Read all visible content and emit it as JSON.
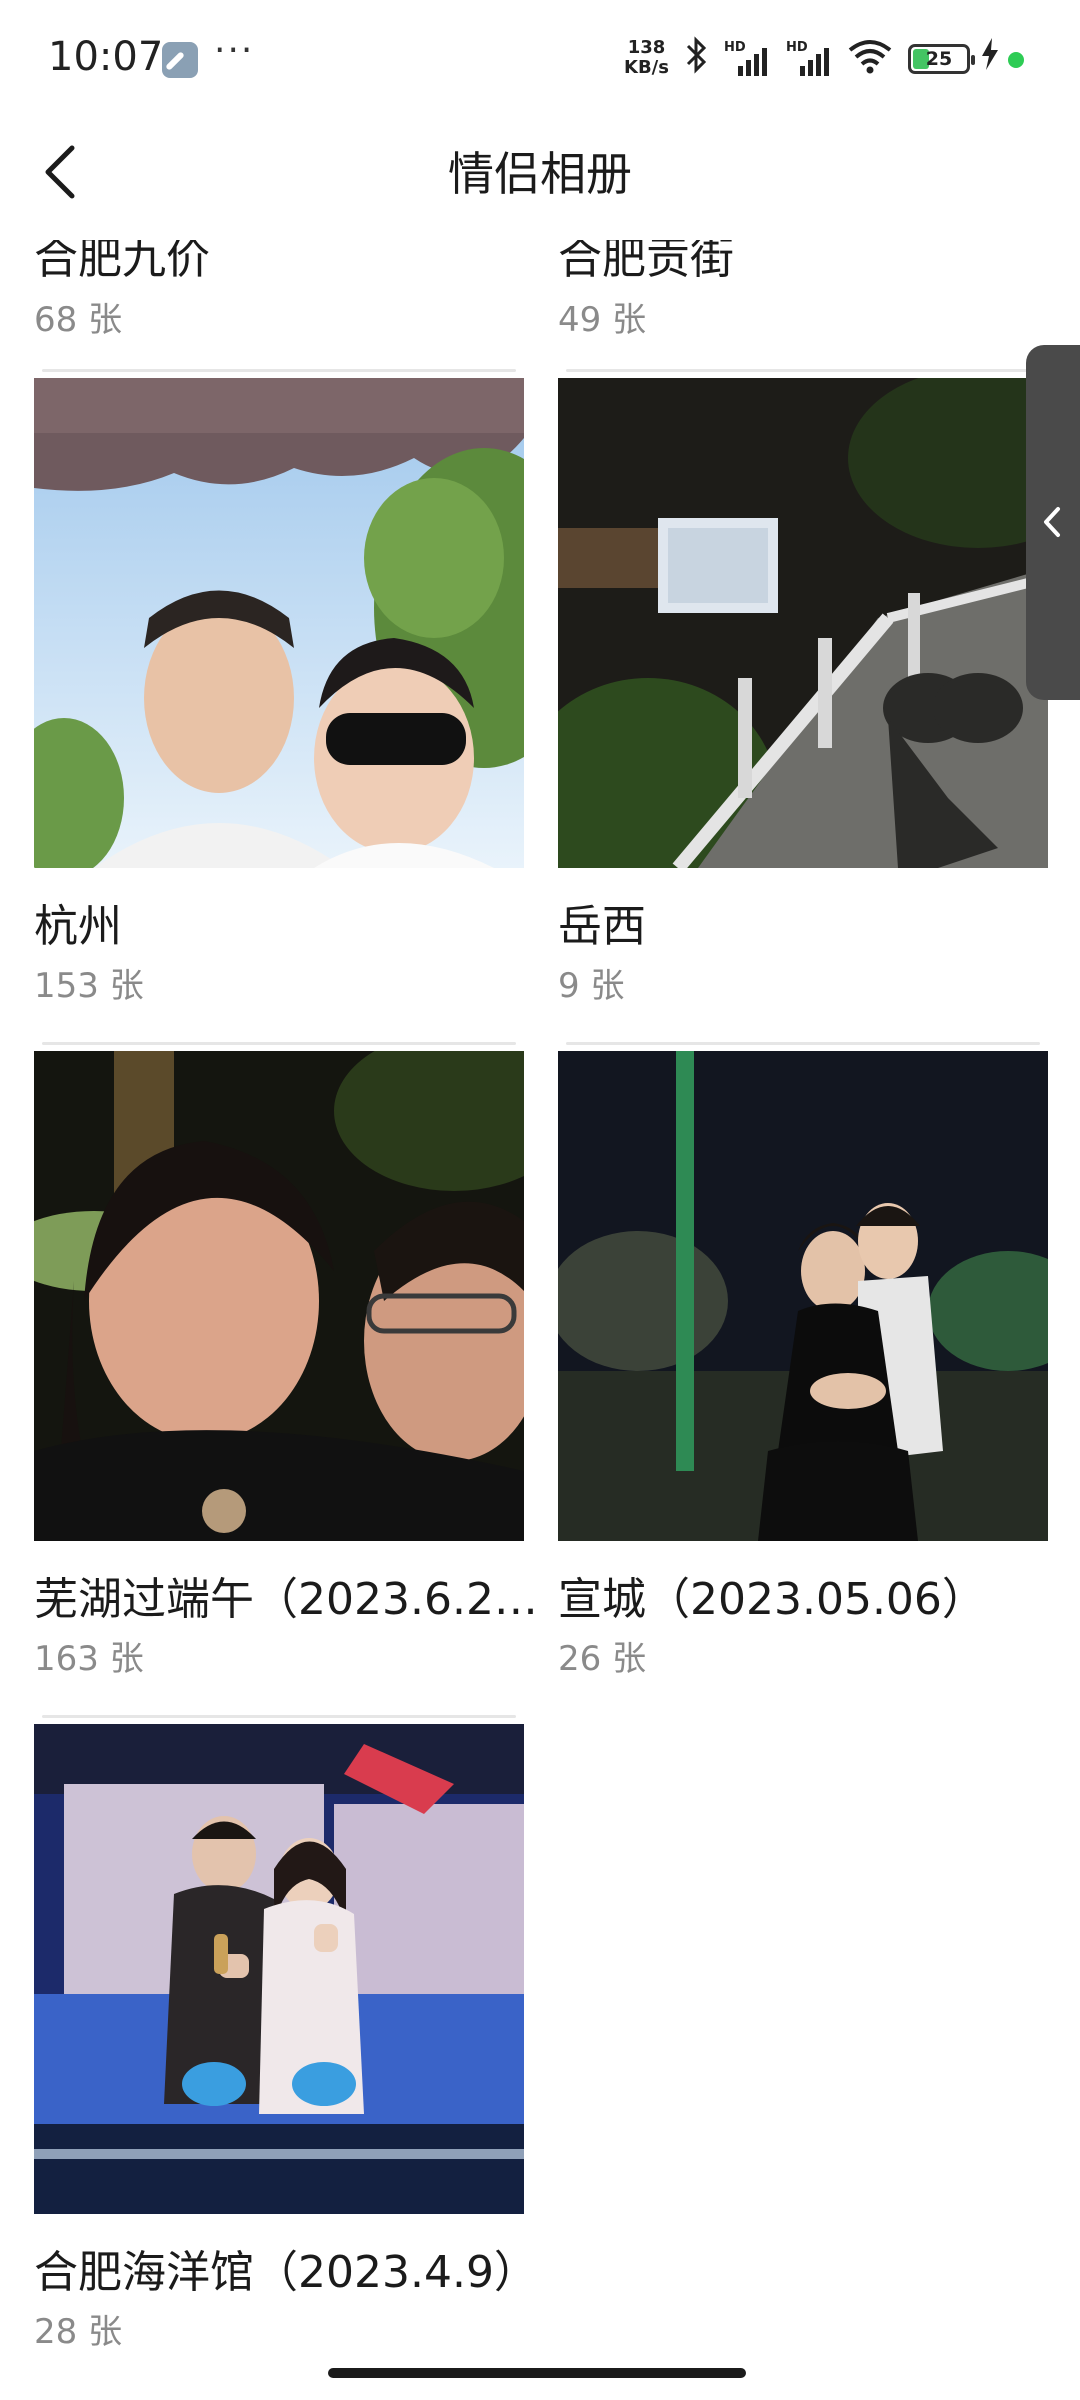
{
  "status_bar": {
    "time": "10:07",
    "dots": "···",
    "speed_top": "138",
    "speed_bottom": "KB/s",
    "sim1": "HD",
    "sim2": "HD",
    "battery": "25",
    "icons": [
      "wrench-icon",
      "bluetooth-icon",
      "signal-icon",
      "wifi-icon",
      "battery-icon",
      "charging-icon"
    ]
  },
  "header": {
    "title": "情侣相册"
  },
  "albums_partial": [
    {
      "name": "合肥九价",
      "count": "68 张"
    },
    {
      "name": "合肥贡街",
      "count": "49 张"
    }
  ],
  "albums": [
    {
      "name": "杭州",
      "count": "153 张"
    },
    {
      "name": "岳西",
      "count": "9 张"
    },
    {
      "name": "芜湖过端午（2023.6.2…",
      "count": "163 张"
    },
    {
      "name": "宣城（2023.05.06）",
      "count": "26 张"
    },
    {
      "name": "合肥海洋馆（2023.4.9）",
      "count": "28 张"
    }
  ],
  "colors": {
    "count_text": "#8a8a8a",
    "side_tab": "#4a4a4a",
    "battery_fill": "#43c463"
  }
}
